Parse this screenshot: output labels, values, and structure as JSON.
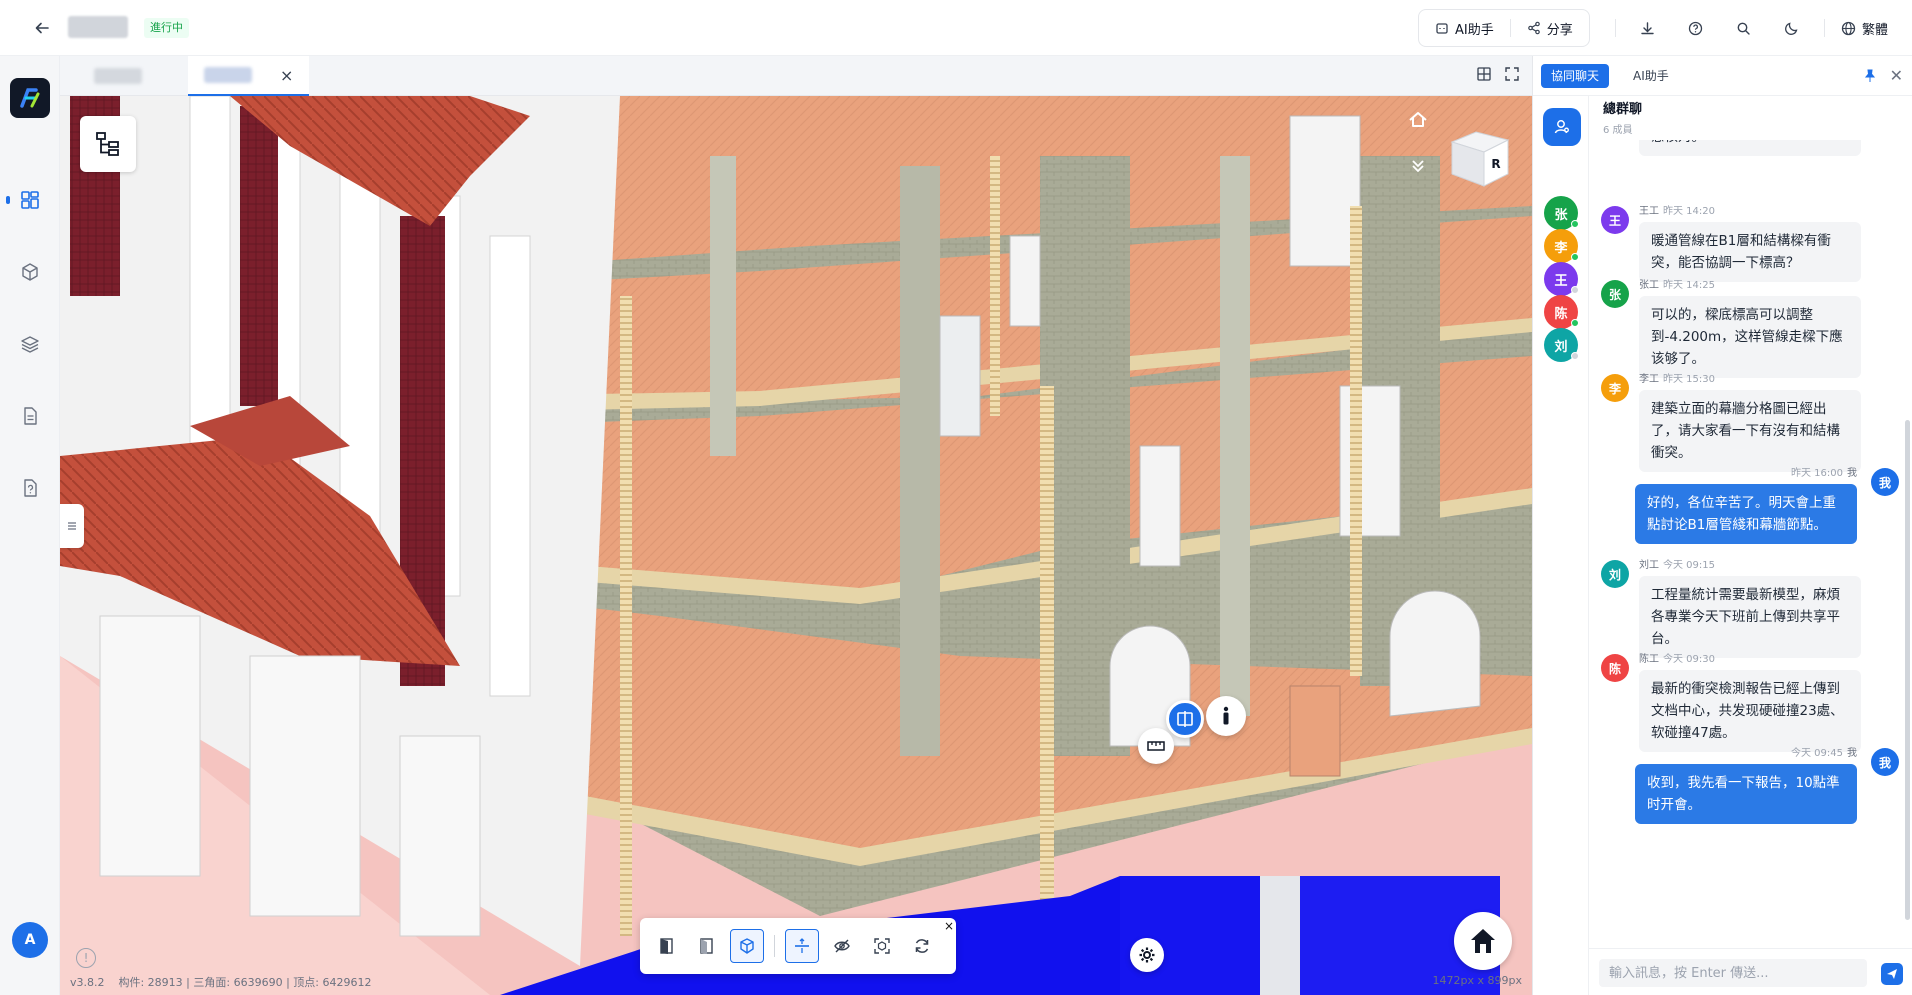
{
  "header": {
    "status_badge": "進行中",
    "ai_button_label": "AI助手",
    "share_button_label": "分享",
    "language_label": "繁體"
  },
  "viewer": {
    "stats": "v3.8.2    构件: 28913 | 三角面: 6639690 | 顶点: 6429612",
    "dimensions": "1472px x 899px",
    "viewcube_label": "R"
  },
  "panel": {
    "tabs": [
      "協同聊天",
      "AI助手"
    ],
    "chat_title": "總群聊",
    "member_count": "6 成員",
    "members": [
      {
        "initial": "张",
        "color": "#16a34a",
        "dot": "#22c55e"
      },
      {
        "initial": "李",
        "color": "#f59e0b",
        "dot": "#22c55e"
      },
      {
        "initial": "王",
        "color": "#7c3aed",
        "dot": "#d1d5db"
      },
      {
        "initial": "陈",
        "color": "#ef4444",
        "dot": "#22c55e"
      },
      {
        "initial": "刘",
        "color": "#0ea5a5",
        "dot": "#d1d5db"
      }
    ],
    "messages": [
      {
        "from": "",
        "avatar": "",
        "color": "",
        "time": "",
        "text": "意核对。",
        "me": false
      },
      {
        "from": "王工",
        "avatar": "王",
        "color": "#7c3aed",
        "time": "昨天 14:20",
        "text": "暖通管線在B1層和結構樑有衝突，能否協調一下標高？",
        "me": false
      },
      {
        "from": "张工",
        "avatar": "张",
        "color": "#16a34a",
        "time": "昨天 14:25",
        "text": "可以的，樑底標高可以調整到-4.200m，这样管線走樑下應该够了。",
        "me": false
      },
      {
        "from": "李工",
        "avatar": "李",
        "color": "#f59e0b",
        "time": "昨天 15:30",
        "text": "建築立面的幕牆分格圖已經出了，请大家看一下有沒有和結構衝突。",
        "me": false
      },
      {
        "from": "我",
        "avatar": "我",
        "color": "#1d6fe8",
        "time": "昨天 16:00",
        "text": "好的，各位辛苦了。明天會上重點討论B1層管綫和幕牆節點。",
        "me": true
      },
      {
        "from": "刘工",
        "avatar": "刘",
        "color": "#0ea5a5",
        "time": "今天 09:15",
        "text": "工程量統计需要最新模型，麻煩各專業今天下班前上傳到共享平台。",
        "me": false
      },
      {
        "from": "陈工",
        "avatar": "陈",
        "color": "#ef4444",
        "time": "今天 09:30",
        "text": "最新的衝突檢測報告已經上傳到文档中心，共发现硬碰撞23處、软碰撞47處。",
        "me": false
      },
      {
        "from": "我",
        "avatar": "我",
        "color": "#1d6fe8",
        "time": "今天 09:45",
        "text": "收到，我先看一下報告，10點準时开會。",
        "me": true
      }
    ],
    "input_placeholder": "輸入訊息，按 Enter 傳送..."
  },
  "sidebar": {
    "avatar_initial": "A"
  }
}
